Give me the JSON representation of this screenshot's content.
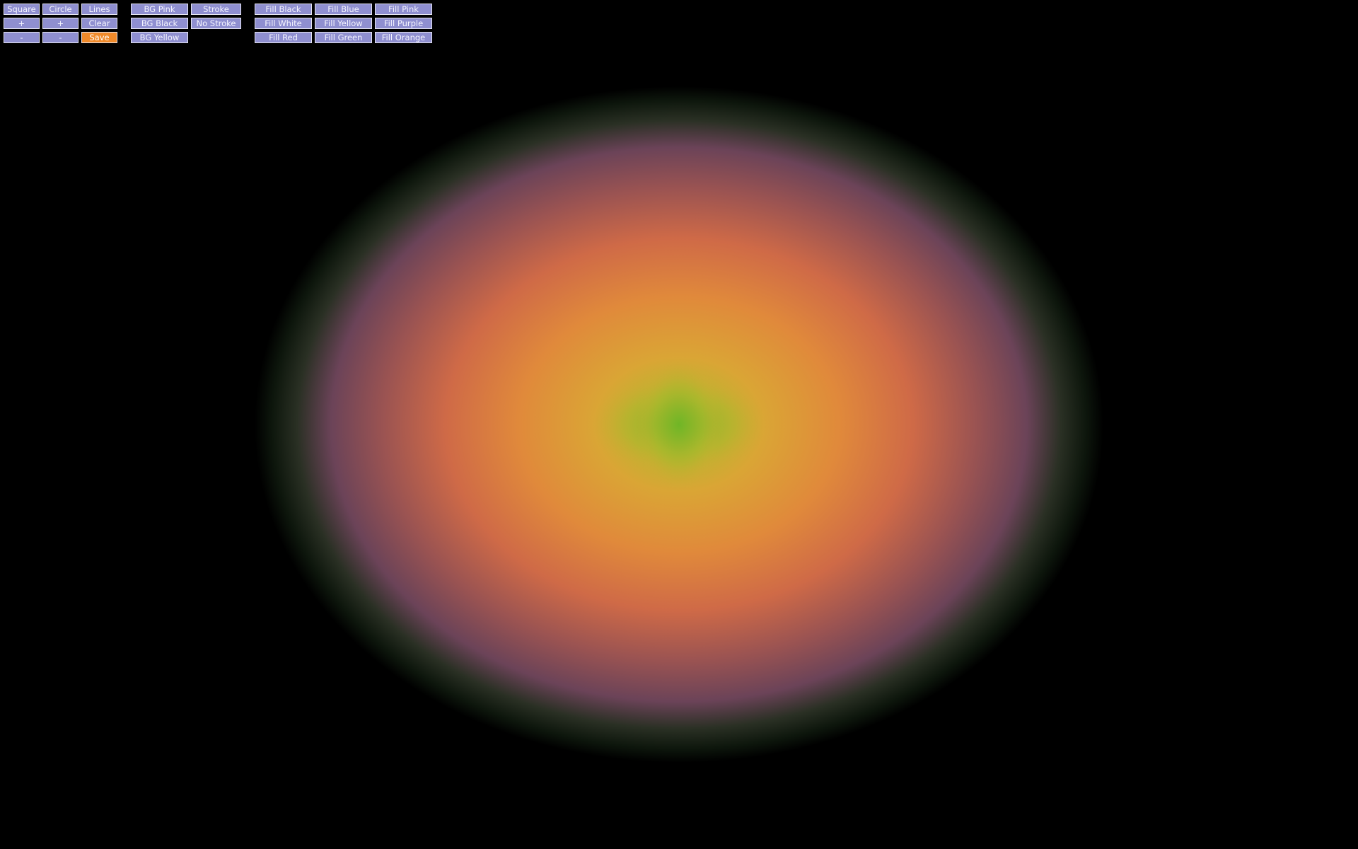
{
  "app": {
    "background_color": "#000000",
    "button_color": "#8f8fd0",
    "button_active_color": "#f08a2a",
    "button_border_color": "#e6e6f2"
  },
  "shape_controls": {
    "square": "Square",
    "circle": "Circle",
    "lines": "Lines",
    "increase_a": "+",
    "increase_b": "+",
    "clear": "Clear",
    "decrease_a": "-",
    "decrease_b": "-",
    "save": "Save"
  },
  "background_controls": {
    "bg_pink": "BG Pink",
    "bg_black": "BG Black",
    "bg_yellow": "BG Yellow"
  },
  "stroke_controls": {
    "stroke": "Stroke",
    "no_stroke": "No Stroke"
  },
  "fill_controls": {
    "fill_black": "Fill Black",
    "fill_blue": "Fill Blue",
    "fill_pink": "Fill Pink",
    "fill_white": "Fill White",
    "fill_yellow": "Fill Yellow",
    "fill_purple": "Fill Purple",
    "fill_red": "Fill Red",
    "fill_green": "Fill Green",
    "fill_orange": "Fill Orange"
  },
  "artwork": {
    "description_colors": [
      "#0c1a0c",
      "#5a3a55",
      "#8a4f50",
      "#c96a48",
      "#e08a3c",
      "#d8a833",
      "#7cb82a"
    ]
  }
}
